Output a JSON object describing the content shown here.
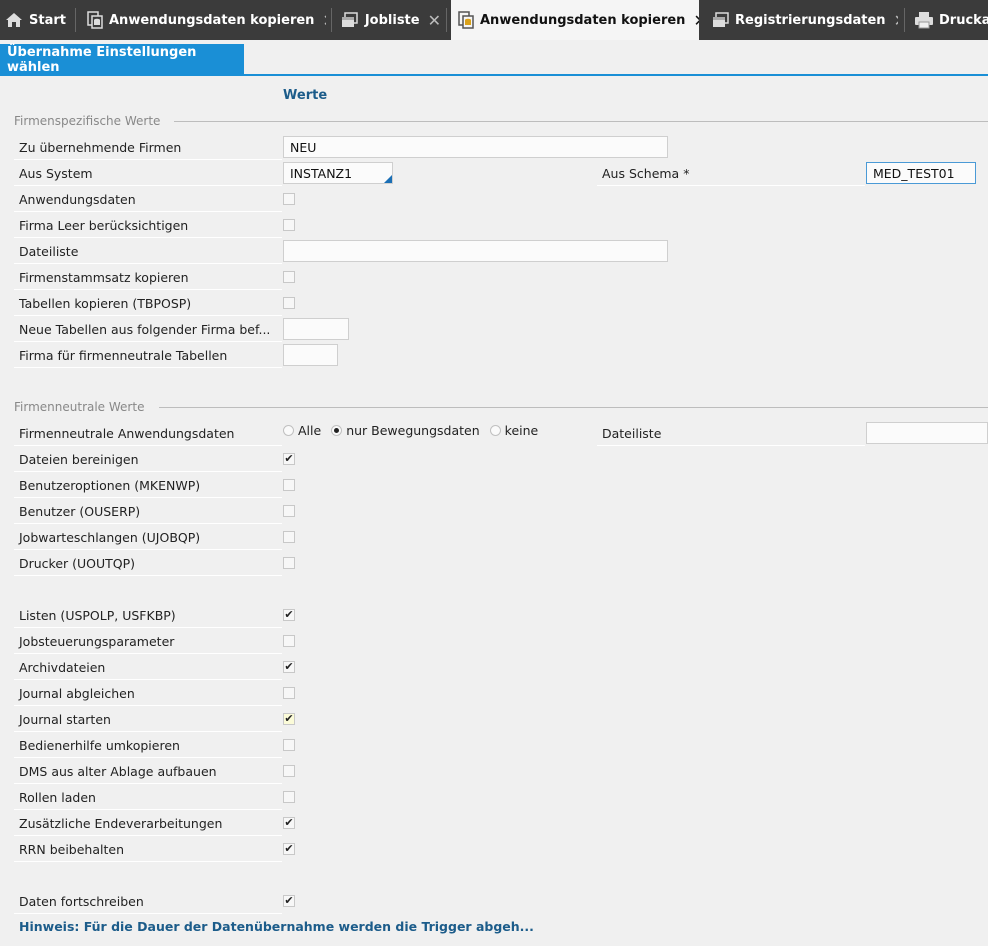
{
  "tabs": [
    {
      "label": "Start",
      "icon": "home-icon",
      "closable": false
    },
    {
      "label": "Anwendungsdaten kopieren",
      "icon": "copy-db-icon",
      "closable": true
    },
    {
      "label": "Jobliste",
      "icon": "window-icon",
      "closable": true
    },
    {
      "label": "Anwendungsdaten kopieren",
      "icon": "copy-db-icon",
      "closable": true,
      "active": true
    },
    {
      "label": "Registrierungsdaten",
      "icon": "window-icon",
      "closable": true
    },
    {
      "label": "Druckausgabe",
      "icon": "printer-icon",
      "closable": false
    }
  ],
  "close_glyph": "✕",
  "subtab": "Übernahme Einstellungen wählen",
  "column_header": "Werte",
  "section1": "Firmenspezifische Werte",
  "section2": "Firmenneutrale Werte",
  "fields": {
    "firmen": {
      "label": "Zu übernehmende Firmen",
      "value": "NEU"
    },
    "aus_system": {
      "label": "Aus System",
      "value": "INSTANZ1"
    },
    "aus_schema": {
      "label": "Aus Schema *",
      "value": "MED_TEST01"
    },
    "anwendungsdaten": {
      "label": "Anwendungsdaten",
      "checked": false
    },
    "firma_leer": {
      "label": "Firma Leer berücksichtigen",
      "checked": false
    },
    "dateiliste": {
      "label": "Dateiliste",
      "value": ""
    },
    "firmenstamm": {
      "label": "Firmenstammsatz kopieren",
      "checked": false
    },
    "tabellen": {
      "label": "Tabellen kopieren (TBPOSP)",
      "checked": false
    },
    "neue_tabellen": {
      "label": "Neue Tabellen aus folgender Firma bef...",
      "value": ""
    },
    "firma_neutral": {
      "label": "Firma für firmenneutrale Tabellen",
      "value": ""
    }
  },
  "neutral": {
    "anwendungsdaten_label": "Firmenneutrale Anwendungsdaten",
    "radio_options": [
      "Alle",
      "nur Bewegungsdaten",
      "keine"
    ],
    "radio_selected": "nur Bewegungsdaten",
    "dateiliste_label": "Dateiliste",
    "dateiliste_value": ""
  },
  "checkbox_rows": [
    {
      "label": "Dateien bereinigen",
      "checked": true
    },
    {
      "label": "Benutzeroptionen (MKENWP)",
      "checked": false
    },
    {
      "label": "Benutzer (OUSERP)",
      "checked": false
    },
    {
      "label": "Jobwarteschlangen (UJOBQP)",
      "checked": false
    },
    {
      "label": "Drucker (UOUTQP)",
      "checked": false
    },
    {
      "label": "Listen (USPOLP, USFKBP)",
      "checked": true
    },
    {
      "label": "Jobsteuerungsparameter",
      "checked": false
    },
    {
      "label": "Archivdateien",
      "checked": true
    },
    {
      "label": "Journal abgleichen",
      "checked": false
    },
    {
      "label": "Journal starten",
      "checked": true,
      "highlight": true
    },
    {
      "label": "Bedienerhilfe umkopieren",
      "checked": false
    },
    {
      "label": "DMS aus alter Ablage aufbauen",
      "checked": false
    },
    {
      "label": "Rollen laden",
      "checked": false
    },
    {
      "label": "Zusätzliche Endeverarbeitungen",
      "checked": true
    },
    {
      "label": "RRN beibehalten",
      "checked": true
    },
    {
      "label": "Daten fortschreiben",
      "checked": true
    }
  ],
  "check_glyph": "✔",
  "hint": "Hinweis: Für die Dauer der Datenübernahme werden die Trigger abgeh..."
}
